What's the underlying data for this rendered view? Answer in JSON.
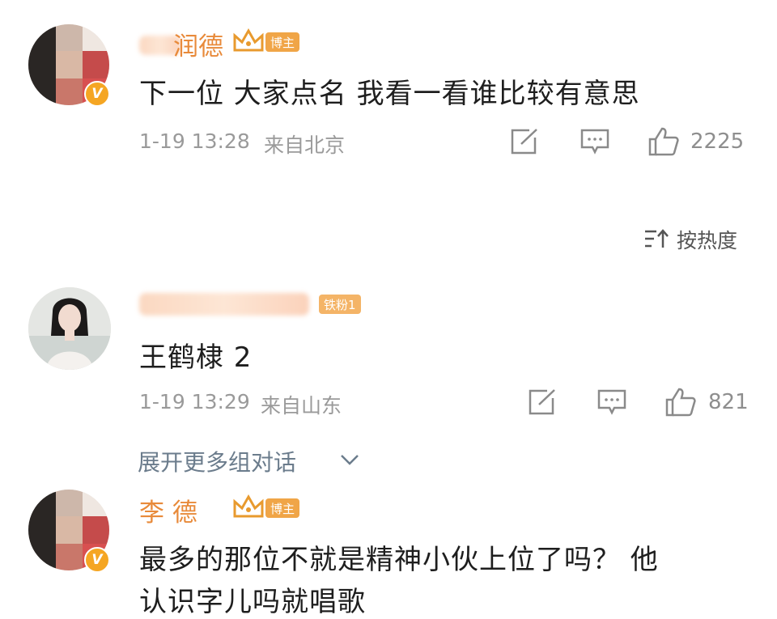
{
  "comments": [
    {
      "author_visible": "润德",
      "badge": "博主",
      "verified_icon": "v-badge-icon",
      "text": "下一位 大家点名 我看一看谁比较有意思",
      "time": "1-19 13:28",
      "location": "来自北京",
      "likes": "2225"
    },
    {
      "badge": "铁粉1",
      "text": "王鹤棣 2",
      "time": "1-19 13:29",
      "location": "来自山东",
      "likes": "821"
    },
    {
      "author_visible": "李 德",
      "badge": "博主",
      "verified_icon": "v-badge-icon",
      "text_line1": "最多的那位不就是精神小伙上位了吗？ 他",
      "text_line2": "认识字儿吗就唱歌"
    }
  ],
  "sort_label": "按热度",
  "expand_label": "展开更多组对话",
  "colors": {
    "name": "#e88a3a",
    "badge": "#f0a547",
    "meta": "#9a9a9a",
    "link": "#6b7c8c"
  }
}
